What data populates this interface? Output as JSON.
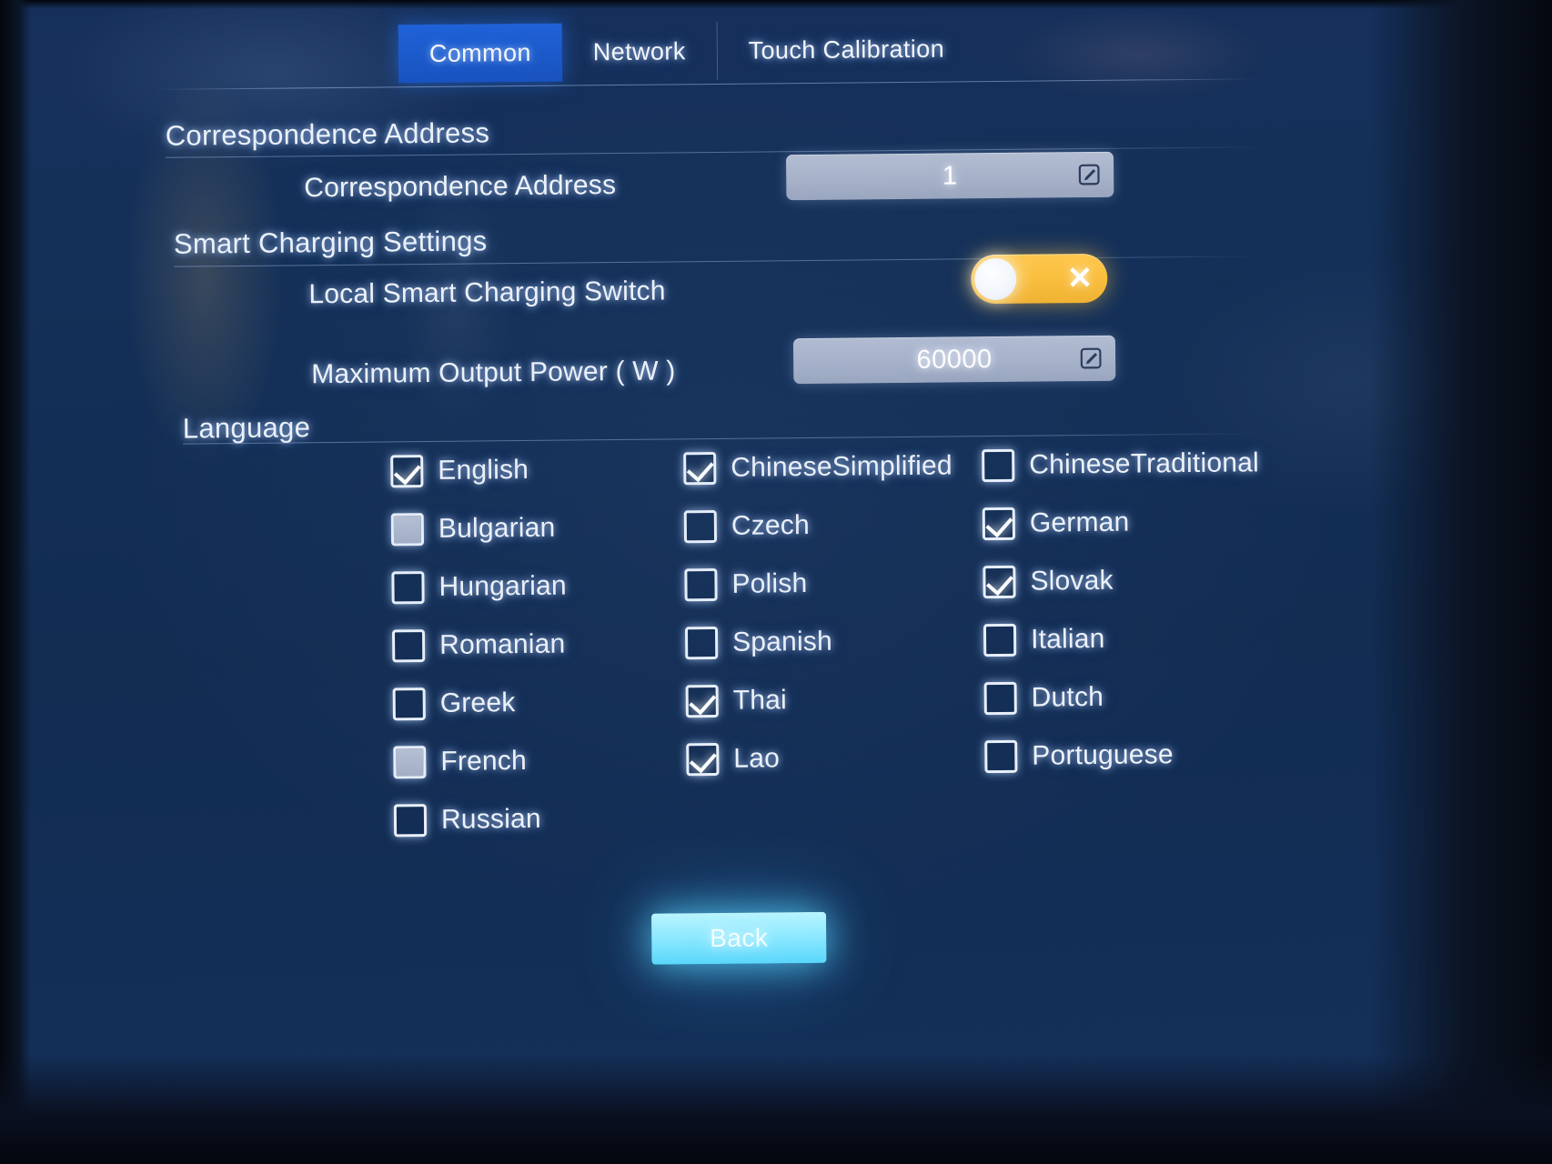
{
  "tabs": [
    {
      "label": "Common",
      "active": true
    },
    {
      "label": "Network",
      "active": false
    },
    {
      "label": "Touch Calibration",
      "active": false
    }
  ],
  "sections": {
    "correspondence": {
      "title": "Correspondence Address",
      "field_label": "Correspondence Address",
      "value": "1",
      "edit_icon": "edit-square-icon"
    },
    "smart_charging": {
      "title": "Smart Charging Settings",
      "switch_label": "Local Smart Charging Switch",
      "switch_state": "off",
      "switch_mark": "✕",
      "power_label": "Maximum Output Power ( W )",
      "power_value": "60000",
      "edit_icon": "edit-square-icon"
    },
    "language": {
      "title": "Language",
      "columns": [
        [
          {
            "label": "English",
            "state": "checked"
          },
          {
            "label": "Bulgarian",
            "state": "filled"
          },
          {
            "label": "Hungarian",
            "state": "unchecked"
          },
          {
            "label": "Romanian",
            "state": "unchecked"
          },
          {
            "label": "Greek",
            "state": "unchecked"
          },
          {
            "label": "French",
            "state": "filled"
          },
          {
            "label": "Russian",
            "state": "unchecked"
          }
        ],
        [
          {
            "label": "ChineseSimplified",
            "state": "checked"
          },
          {
            "label": "Czech",
            "state": "unchecked"
          },
          {
            "label": "Polish",
            "state": "unchecked"
          },
          {
            "label": "Spanish",
            "state": "unchecked"
          },
          {
            "label": "Thai",
            "state": "checked"
          },
          {
            "label": "Lao",
            "state": "checked"
          }
        ],
        [
          {
            "label": "ChineseTraditional",
            "state": "unchecked"
          },
          {
            "label": "German",
            "state": "checked"
          },
          {
            "label": "Slovak",
            "state": "checked"
          },
          {
            "label": "Italian",
            "state": "unchecked"
          },
          {
            "label": "Dutch",
            "state": "unchecked"
          },
          {
            "label": "Portuguese",
            "state": "unchecked"
          }
        ]
      ]
    }
  },
  "footer": {
    "back_label": "Back"
  },
  "colors": {
    "accent_tab": "#1f62d8",
    "toggle_on_track": "#fbbf3c",
    "input_bg": "#a7b2c9",
    "back_button": "#8fe9ff",
    "screen_bg": "#143058"
  }
}
